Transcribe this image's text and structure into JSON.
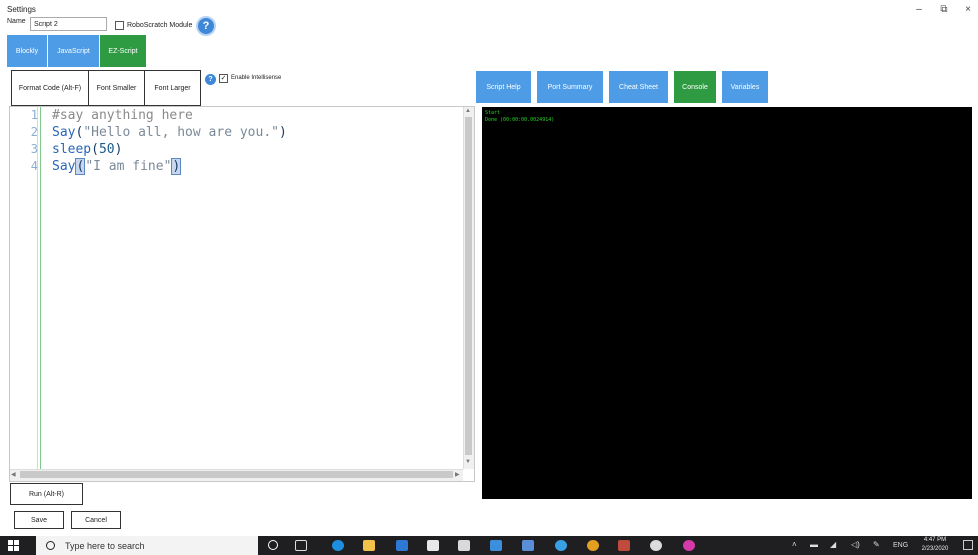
{
  "window": {
    "title": "Settings",
    "minimize_glyph": "–",
    "restore_glyph": "⧉",
    "close_glyph": "×"
  },
  "name_row": {
    "label": "Name",
    "value": "Script 2",
    "robo_label": "RoboScratch Module",
    "help_glyph": "?"
  },
  "lang_tabs": [
    {
      "label": "Blockly",
      "active": false
    },
    {
      "label": "JavaScript",
      "active": false
    },
    {
      "label": "EZ-Script",
      "active": true
    }
  ],
  "format_buttons": {
    "format": "Format Code (Alt-F)",
    "smaller": "Font Smaller",
    "larger": "Font Larger"
  },
  "intellisense": {
    "help_glyph": "?",
    "checked_glyph": "✓",
    "label": "Enable Intellisense"
  },
  "right_tabs": [
    {
      "label": "Script Help",
      "active": false
    },
    {
      "label": "Port Summary",
      "active": false
    },
    {
      "label": "Cheat Sheet",
      "active": false
    },
    {
      "label": "Console",
      "active": true
    },
    {
      "label": "Variables",
      "active": false
    }
  ],
  "editor": {
    "line_numbers": [
      "1",
      "2",
      "3",
      "4"
    ],
    "line1": "#say anything here",
    "line2_func": "Say",
    "line2_open": "(",
    "line2_str": "\"Hello all, how are you.\"",
    "line2_close": ")",
    "line3_func": "sleep",
    "line3_open": "(",
    "line3_num": "50",
    "line3_close": ")",
    "line4_func": "Say",
    "line4_open": "(",
    "line4_str": "\"I am fine\"",
    "line4_close": ")"
  },
  "console": {
    "lines": [
      "Start",
      "Done (00:00:00.0024914)"
    ]
  },
  "buttons": {
    "run": "Run (Alt-R)",
    "save": "Save",
    "cancel": "Cancel"
  },
  "taskbar": {
    "search_placeholder": "Type here to search",
    "lang": "ENG",
    "time": "4:47 PM",
    "date": "2/23/2020"
  },
  "colors": {
    "tab_blue": "#4e9be6",
    "tab_green": "#2e9b43",
    "console_bg": "#000000",
    "console_text": "#29d129"
  }
}
